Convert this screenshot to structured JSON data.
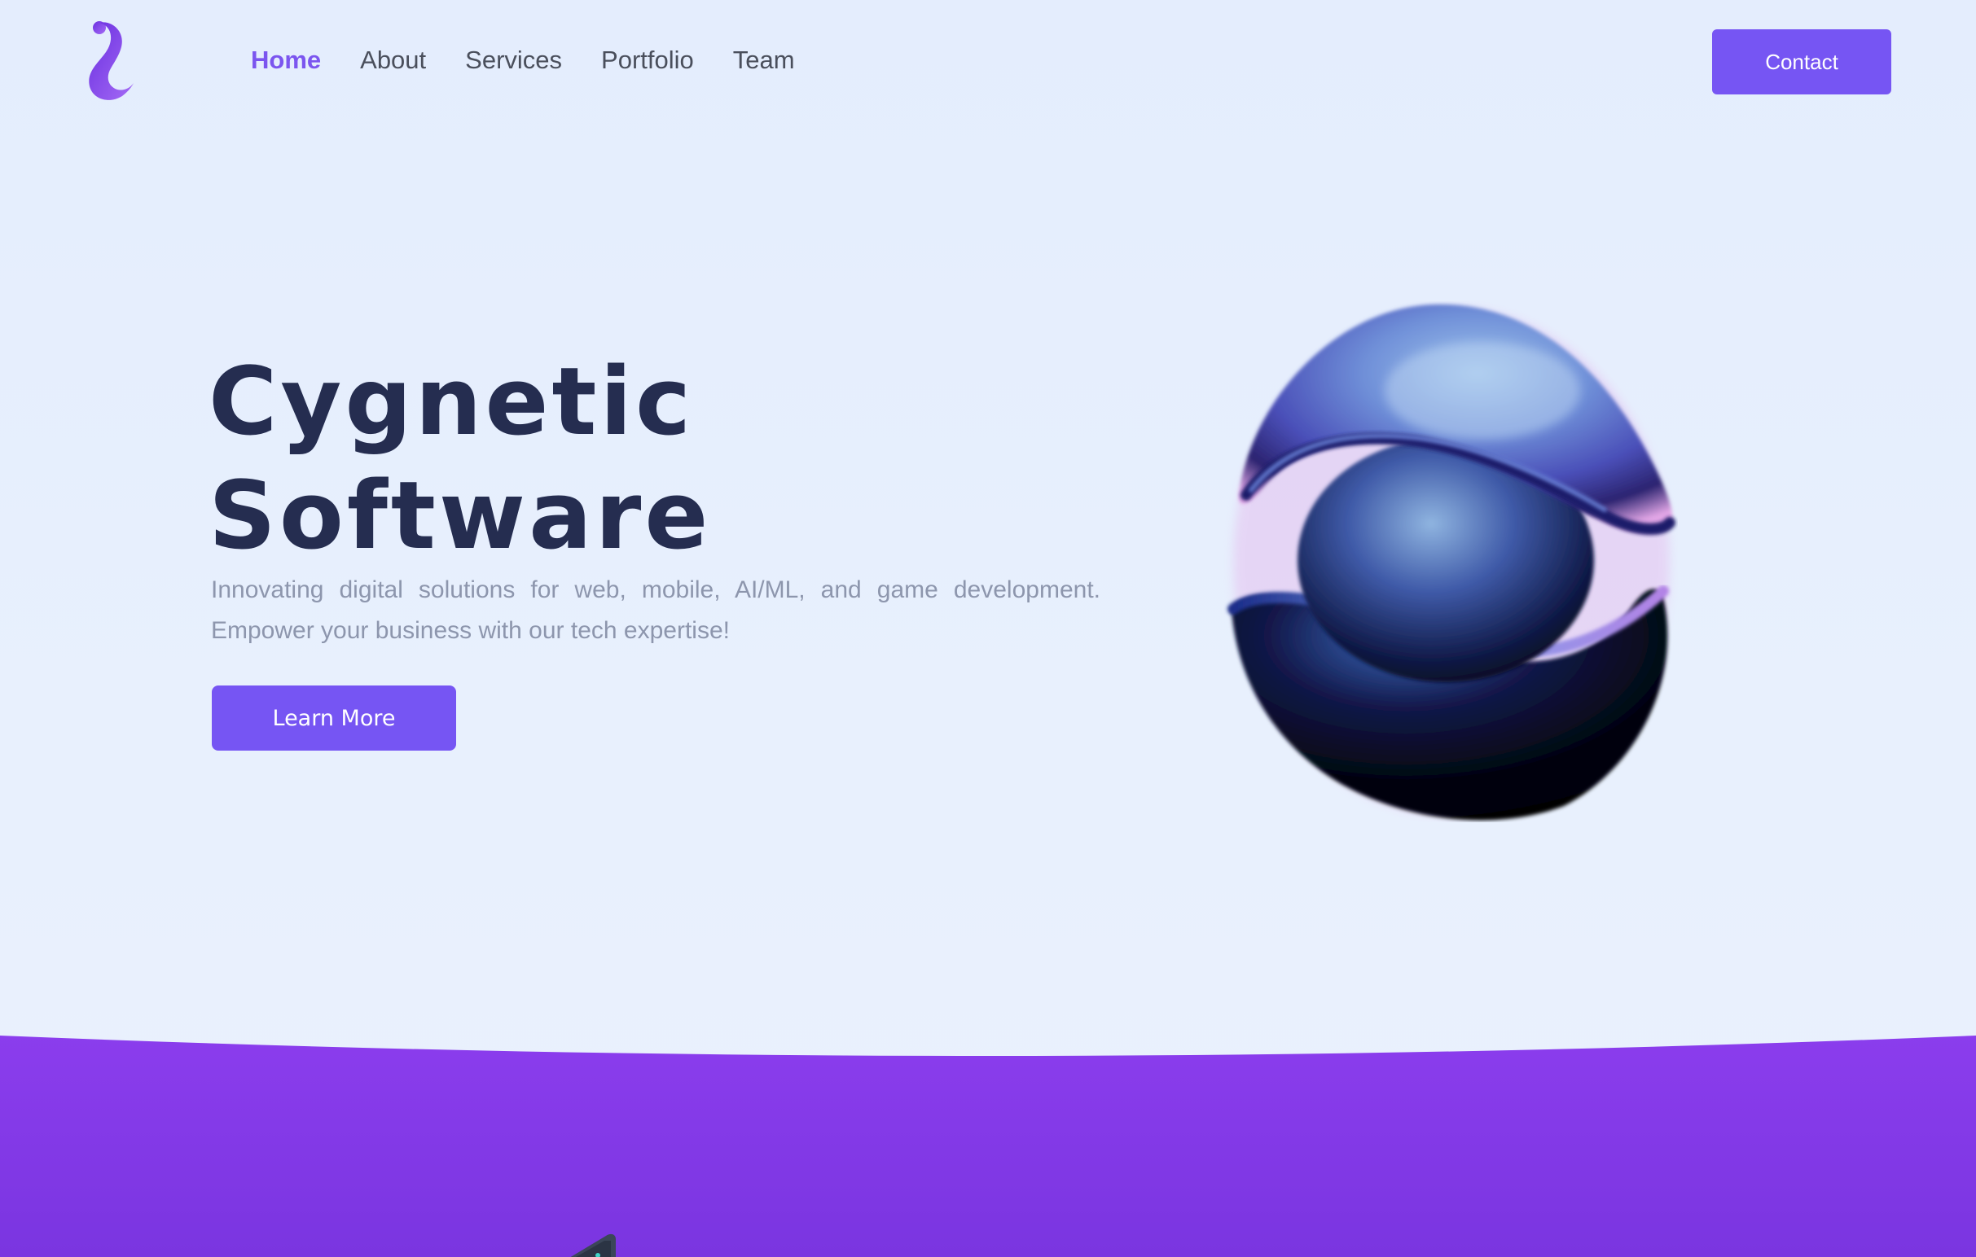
{
  "brand": {
    "logo_icon": "squiggle-logo-icon",
    "accent_color": "#7655f3",
    "logo_gradient": [
      "#6a2fe0",
      "#a56bf5"
    ]
  },
  "nav": {
    "links": [
      {
        "label": "Home",
        "active": true
      },
      {
        "label": "About",
        "active": false
      },
      {
        "label": "Services",
        "active": false
      },
      {
        "label": "Portfolio",
        "active": false
      },
      {
        "label": "Team",
        "active": false
      }
    ],
    "contact_label": "Contact"
  },
  "hero": {
    "title_line1": "Cygnetic",
    "title_line2": "Software",
    "subtitle": "Innovating digital solutions for web, mobile, AI/ML, and game development. Empower your business with our tech expertise!",
    "cta_label": "Learn More",
    "title_color": "#252d50",
    "subtitle_color": "#8d96ad",
    "illustration": "3d-abstract-sphere"
  },
  "section_band": {
    "color_top": "#8b3ded",
    "color_bottom": "#7a35e0"
  }
}
